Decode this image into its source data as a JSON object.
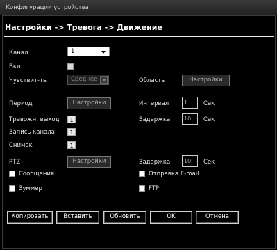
{
  "window": {
    "title": "Конфигурации устройства"
  },
  "breadcrumb": "Настройки -> Тревога -> Движение",
  "channel": {
    "label": "Канал",
    "value": "1"
  },
  "enable": {
    "label": "Вкл"
  },
  "sensitivity": {
    "label": "Чувствит-ть",
    "value": "Среднее"
  },
  "region": {
    "label": "Область",
    "button": "Настройки"
  },
  "period": {
    "label": "Период",
    "button": "Настройки"
  },
  "interval": {
    "label": "Интервал",
    "value": "1",
    "unit": "Сек"
  },
  "alarm_out": {
    "label": "Тревожн. выход",
    "value": "1"
  },
  "delay1": {
    "label": "Задержка",
    "value": "10",
    "unit": "Сек"
  },
  "record_channel": {
    "label": "Запись канала",
    "value": "1"
  },
  "snapshot": {
    "label": "Снимок",
    "value": "1"
  },
  "ptz": {
    "label": "PTZ",
    "button": "Настройки"
  },
  "delay2": {
    "label": "Задержка",
    "value": "10",
    "unit": "Сек"
  },
  "messages": {
    "label": "Сообщения"
  },
  "email": {
    "label": "Отправка E-mail"
  },
  "buzzer": {
    "label": "Зуммер"
  },
  "ftp": {
    "label": "FTP"
  },
  "buttons": {
    "copy": "Копировать",
    "paste": "Вставить",
    "refresh": "Обновить",
    "ok": "OK",
    "cancel": "Отмена"
  }
}
